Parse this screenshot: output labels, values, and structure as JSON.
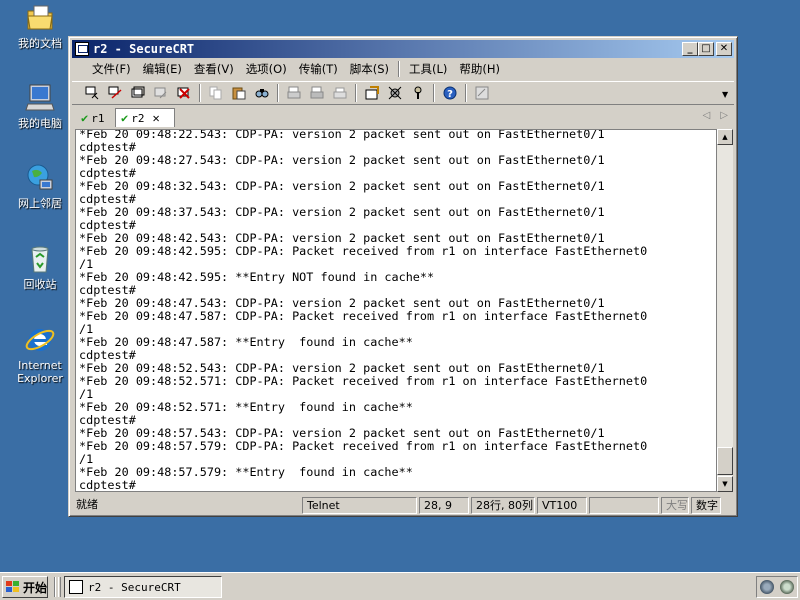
{
  "desktop": {
    "icons": [
      {
        "label": "我的文档",
        "icon": "my-documents-icon"
      },
      {
        "label": "我的电脑",
        "icon": "my-computer-icon"
      },
      {
        "label": "网上邻居",
        "icon": "network-places-icon"
      },
      {
        "label": "回收站",
        "icon": "recycle-bin-icon"
      },
      {
        "label": "Internet",
        "label2": "Explorer",
        "icon": "internet-explorer-icon"
      }
    ]
  },
  "window": {
    "title": "r2 - SecureCRT",
    "menu": [
      "文件(F)",
      "编辑(E)",
      "查看(V)",
      "选项(O)",
      "传输(T)",
      "脚本(S)",
      "工具(L)",
      "帮助(H)"
    ],
    "tabs": [
      {
        "label": "r1",
        "active": false
      },
      {
        "label": "r2",
        "active": true,
        "close": "✕"
      }
    ],
    "terminal_lines": [
      "*Feb 20 09:48:22.543: CDP-PA: version 2 packet sent out on FastEthernet0/1",
      "cdptest#",
      "*Feb 20 09:48:27.543: CDP-PA: version 2 packet sent out on FastEthernet0/1",
      "cdptest#",
      "*Feb 20 09:48:32.543: CDP-PA: version 2 packet sent out on FastEthernet0/1",
      "cdptest#",
      "*Feb 20 09:48:37.543: CDP-PA: version 2 packet sent out on FastEthernet0/1",
      "cdptest#",
      "*Feb 20 09:48:42.543: CDP-PA: version 2 packet sent out on FastEthernet0/1",
      "*Feb 20 09:48:42.595: CDP-PA: Packet received from r1 on interface FastEthernet0",
      "/1",
      "*Feb 20 09:48:42.595: **Entry NOT found in cache**",
      "cdptest#",
      "*Feb 20 09:48:47.543: CDP-PA: version 2 packet sent out on FastEthernet0/1",
      "*Feb 20 09:48:47.587: CDP-PA: Packet received from r1 on interface FastEthernet0",
      "/1",
      "*Feb 20 09:48:47.587: **Entry  found in cache**",
      "cdptest#",
      "*Feb 20 09:48:52.543: CDP-PA: version 2 packet sent out on FastEthernet0/1",
      "*Feb 20 09:48:52.571: CDP-PA: Packet received from r1 on interface FastEthernet0",
      "/1",
      "*Feb 20 09:48:52.571: **Entry  found in cache**",
      "cdptest#",
      "*Feb 20 09:48:57.543: CDP-PA: version 2 packet sent out on FastEthernet0/1",
      "*Feb 20 09:48:57.579: CDP-PA: Packet received from r1 on interface FastEthernet0",
      "/1",
      "*Feb 20 09:48:57.579: **Entry  found in cache**",
      "cdptest#"
    ],
    "status": {
      "ready": "就绪",
      "protocol": "Telnet",
      "cursor": "28,  9",
      "rows_cols": "28行, 80列",
      "emulation": "VT100",
      "empty": "",
      "caps": "大写",
      "num": "数字"
    }
  },
  "taskbar": {
    "start_label": "开始",
    "task_label": "r2 - SecureCRT"
  },
  "colors": {
    "desktop": "#3a6ea5",
    "titlebar_start": "#0a246a",
    "titlebar_end": "#a6caf0",
    "chrome": "#d4d0c8"
  }
}
